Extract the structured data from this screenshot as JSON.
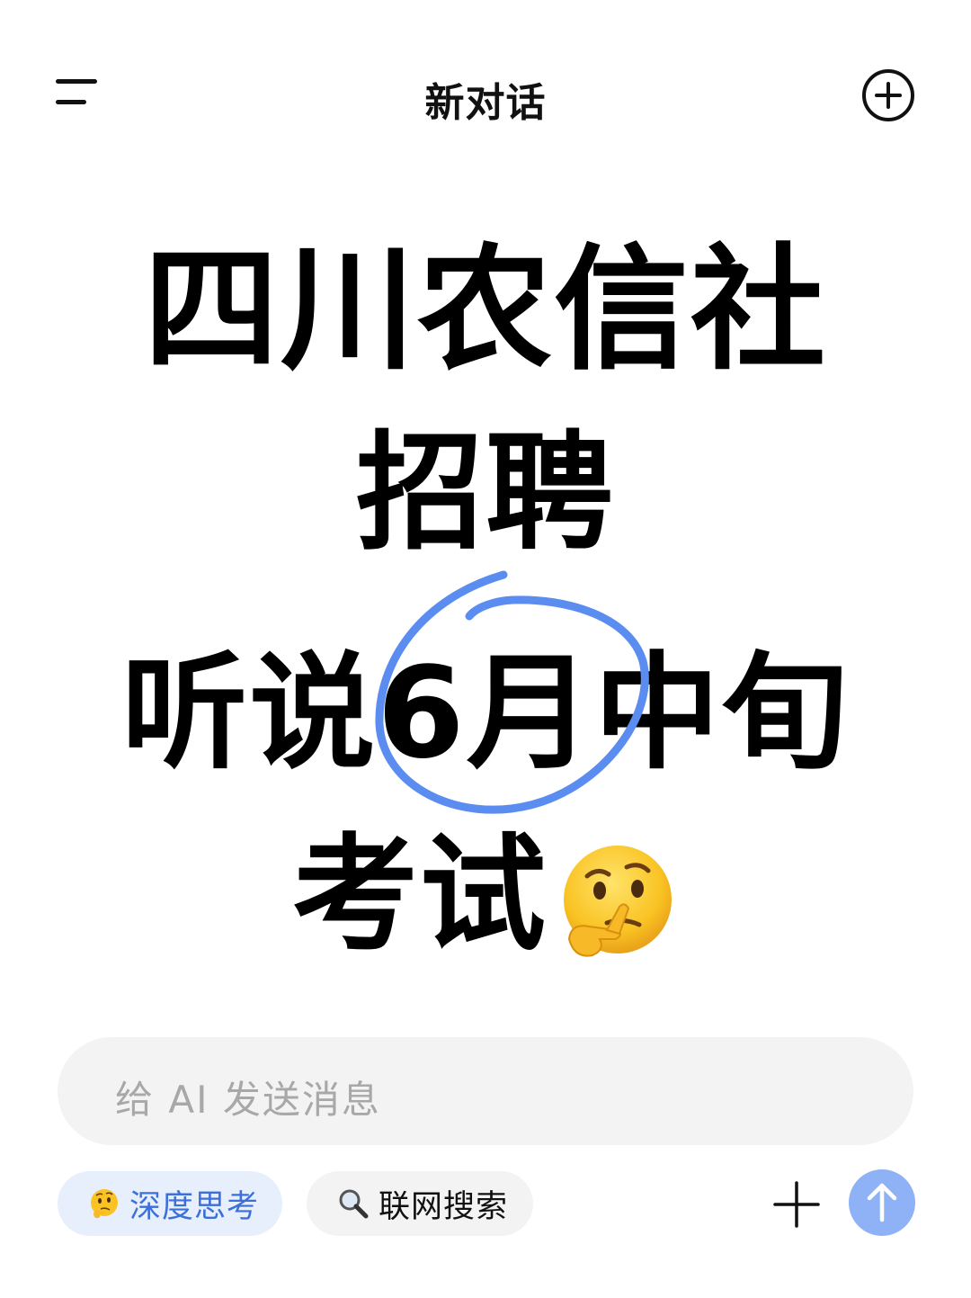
{
  "header": {
    "title": "新对话"
  },
  "headline": {
    "line1": "四川农信社",
    "line2": "招聘",
    "line3": "听说6月中旬",
    "line4": "考试"
  },
  "composer": {
    "placeholder": "给 AI 发送消息"
  },
  "chips": {
    "deep_think": "深度思考",
    "web_search": "联网搜索"
  },
  "colors": {
    "accent": "#3c6fd8",
    "chip_active_bg": "#e7eefc",
    "send_button": "#8fb2f6",
    "circle_stroke": "#5b8df0"
  },
  "icons": {
    "menu": "menu-icon",
    "new_chat": "plus-circle-icon",
    "emoji": "thinking-face-icon",
    "search": "magnifier-icon",
    "attach": "plus-icon",
    "send": "arrow-up-icon"
  }
}
